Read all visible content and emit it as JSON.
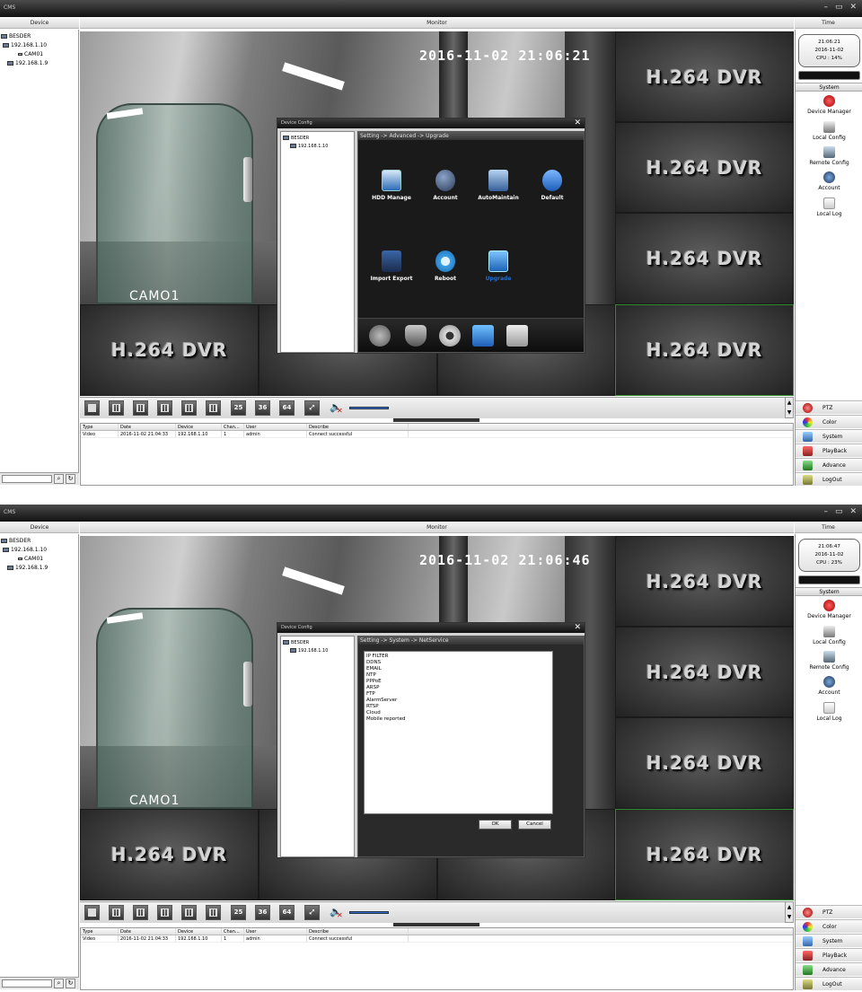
{
  "app_title": "CMS",
  "window_controls": [
    "–",
    "▭",
    "✕"
  ],
  "headers": {
    "device": "Device",
    "monitor": "Monitor",
    "time": "Time"
  },
  "device_tree": [
    {
      "label": "BESDER",
      "icon": "group-icon"
    },
    {
      "label": "192.168.1.10",
      "icon": "dvr-icon"
    },
    {
      "label": "CAM01",
      "icon": "camera-icon"
    },
    {
      "label": "192.168.1.9",
      "icon": "dvr-icon"
    }
  ],
  "video_grid": {
    "placeholder_text": "H.264 DVR",
    "camera_label": "CAMO1"
  },
  "toolbar": {
    "layout_buttons": [
      "",
      "",
      "",
      "",
      "",
      "",
      "25",
      "36",
      "64"
    ],
    "volume": "🔈"
  },
  "log_table": {
    "columns": [
      "Type",
      "Date",
      "Device",
      "Chan...",
      "User",
      "Describe"
    ],
    "rows": [
      [
        "Video",
        "2016-11-02 21:04:33",
        "192.168.1.10",
        "1",
        "admin",
        "Connect successful"
      ]
    ]
  },
  "right_panel": {
    "system_header": "System",
    "system_items": [
      "Device Manager",
      "Local Config",
      "Remote Config",
      "Account",
      "Local Log"
    ],
    "nav_buttons": [
      "PTZ",
      "Color",
      "System",
      "PlayBack",
      "Advance",
      "LogOut"
    ]
  },
  "dialog": {
    "title": "Device Config",
    "close": "✕",
    "tree": [
      {
        "label": "BESDER"
      },
      {
        "label": "192.168.1.10"
      }
    ]
  },
  "screen1": {
    "timestamp": "2016-11-02 21:06:21",
    "clock": {
      "time": "21:06:21",
      "date": "2016-11-02",
      "cpu": "CPU : 14%"
    },
    "breadcrumb": "Setting -> Advanced -> Upgrade",
    "icons": [
      "HDD Manage",
      "Account",
      "AutoMaintain",
      "Default",
      "Import Export",
      "Reboot",
      "Upgrade"
    ]
  },
  "screen2": {
    "timestamp": "2016-11-02 21:06:46",
    "clock": {
      "time": "21:06:47",
      "date": "2016-11-02",
      "cpu": "CPU : 23%"
    },
    "breadcrumb": "Setting -> System -> NetService",
    "netservices": [
      "IP FILTER",
      "DDNS",
      "EMAIL",
      "NTP",
      "PPPoE",
      "ARSP",
      "FTP",
      "AlarmServer",
      "RTSP",
      "Cloud",
      "Mobile reported"
    ],
    "ok": "OK",
    "cancel": "Cancel"
  }
}
